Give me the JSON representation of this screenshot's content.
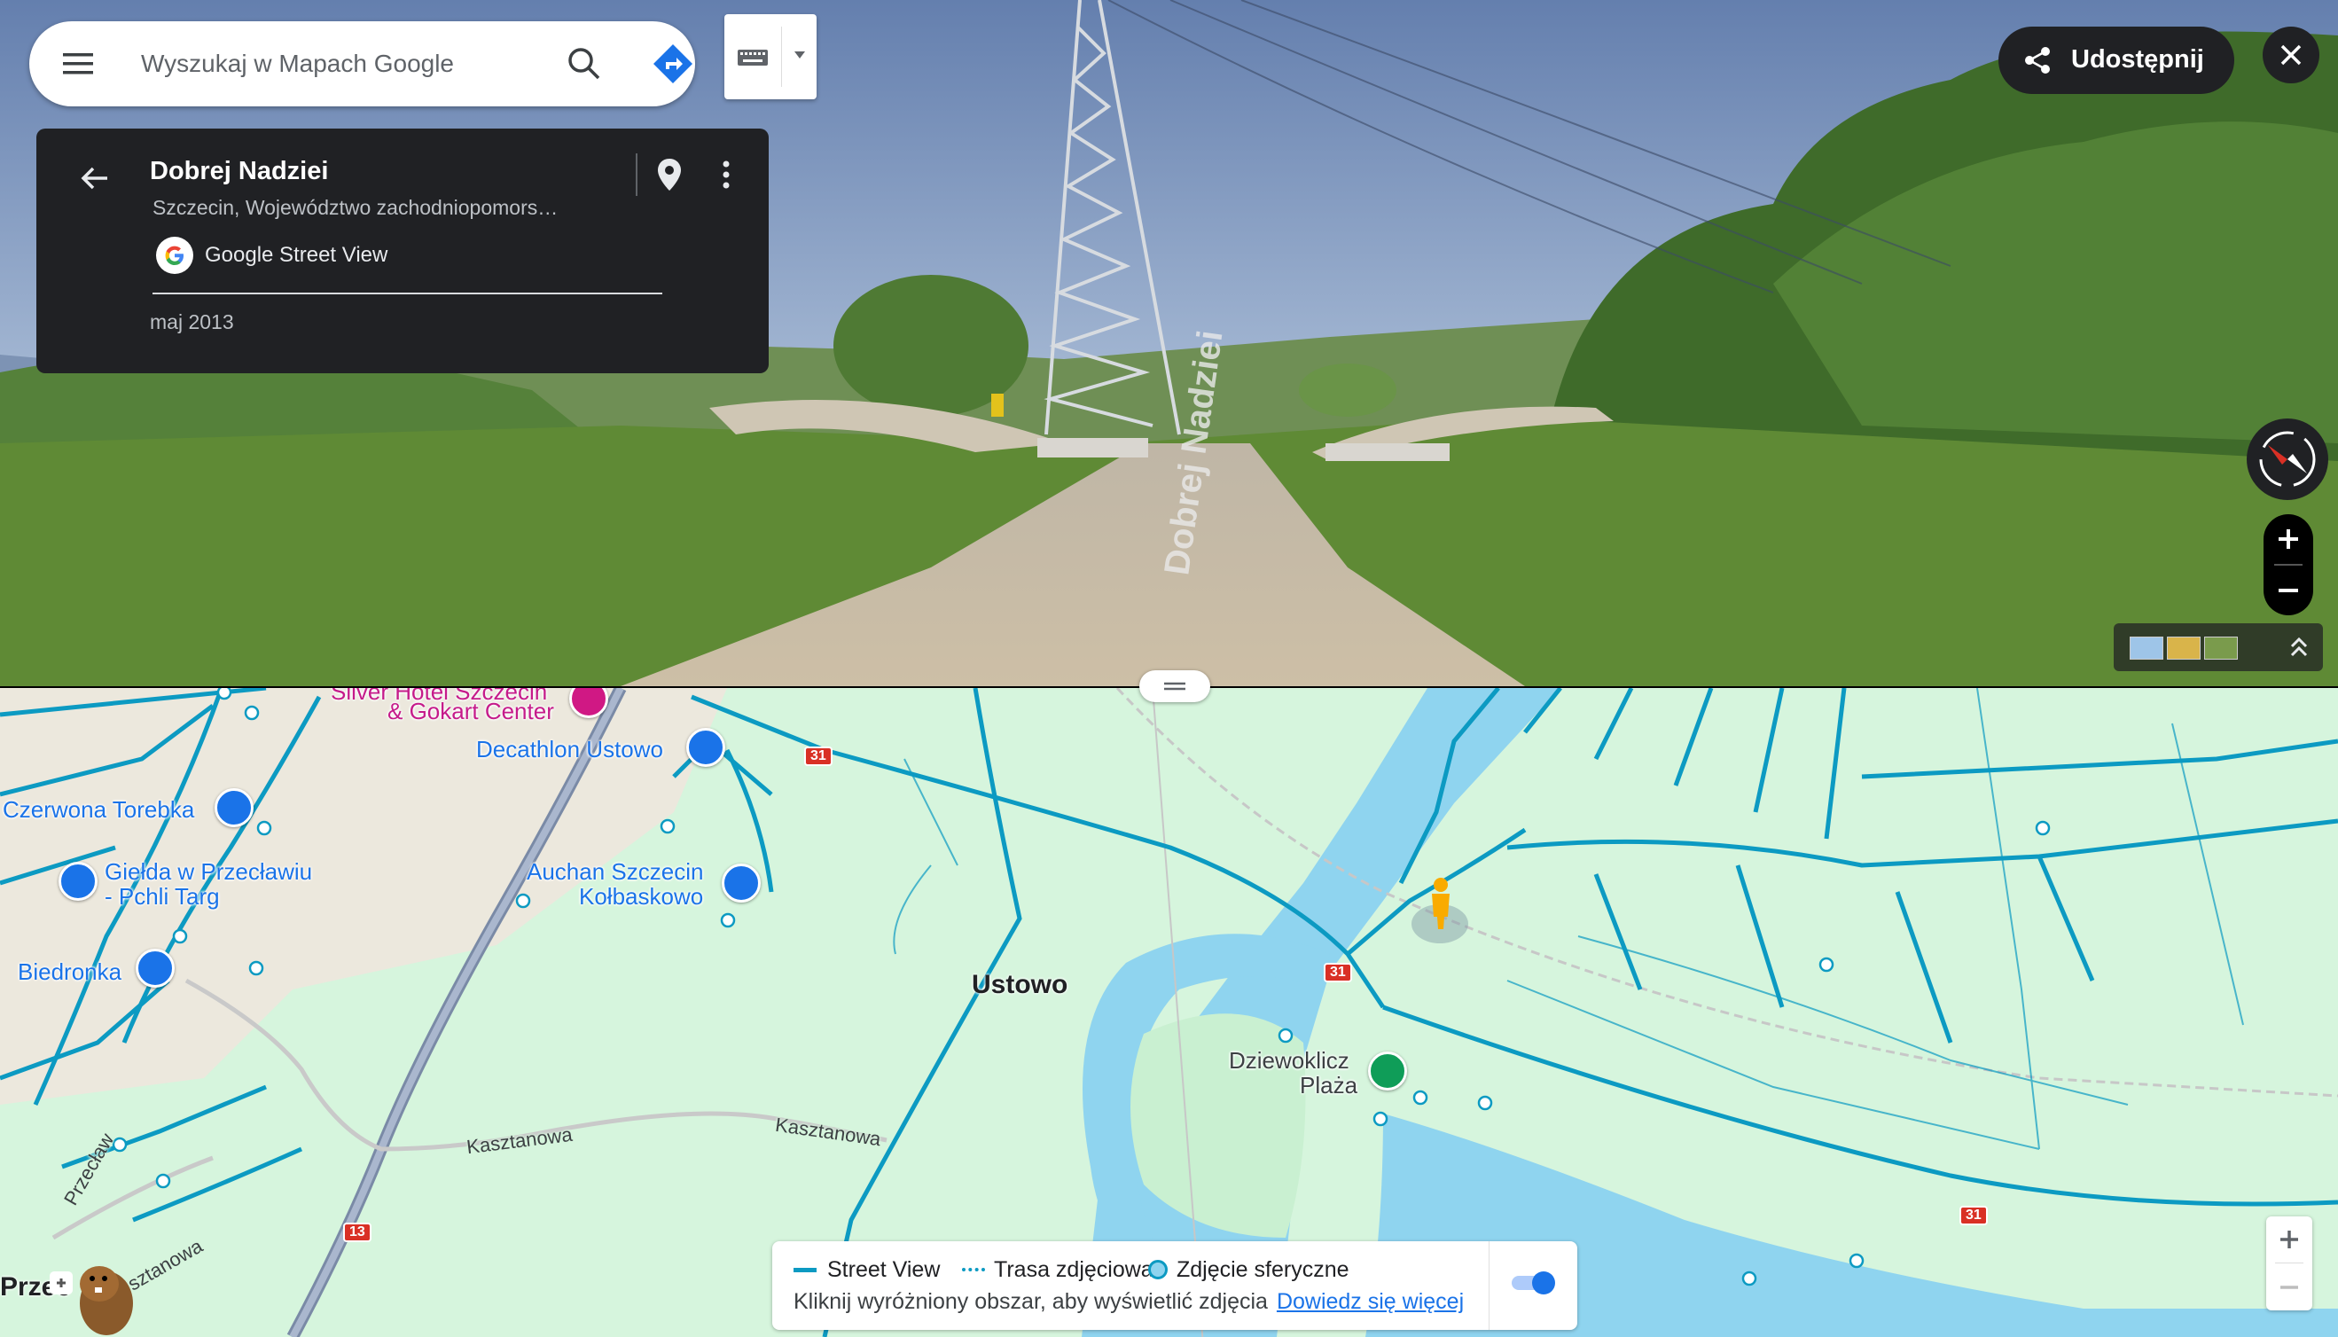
{
  "search": {
    "placeholder": "Wyszukaj w Mapach Google",
    "menu_icon": "hamburger-menu-icon",
    "search_icon": "magnifier-icon",
    "directions_icon": "directions-icon"
  },
  "keyboard": {
    "icon": "keyboard-icon",
    "dropdown_icon": "caret-down-icon"
  },
  "info_card": {
    "title": "Dobrej Nadziei",
    "subtitle": "Szczecin, Województwo zachodniopomors…",
    "source": "Google Street View",
    "date": "maj 2013"
  },
  "share": {
    "label": "Udostępnij"
  },
  "street_view": {
    "road_sign": "Dobrej Nadziei",
    "colors": {
      "sky_top": "#6f87b3",
      "sky_bottom": "#d9e4ee",
      "grass": "#5f8a35",
      "path": "#c4b7a0"
    }
  },
  "map": {
    "pois": {
      "silver_hotel": "Silver Hotel Szczecin",
      "gokart": "& Gokart Center",
      "decathlon": "Decathlon Ustowo",
      "czerwona": "Czerwona Torebka",
      "gielda_1": "Giełda w Przecławiu",
      "gielda_2": "- Pchli Targ",
      "auchan_1": "Auchan Szczecin",
      "auchan_2": "Kołbaskowo",
      "biedronka": "Biedronka",
      "dziewoklicz_1": "Dziewoklicz",
      "dziewoklicz_2": "Plaża"
    },
    "places": {
      "ustowo": "Ustowo",
      "przeclaw_partial": "Przec"
    },
    "roads": {
      "kasztanowa": "Kasztanowa",
      "przeclaw": "Przecław",
      "kasztanowa_partial": "sztanowa"
    },
    "shields": {
      "r31": "31",
      "r13": "13"
    },
    "colors": {
      "land": "#d6f5dd",
      "water": "#8fd4ef",
      "sv_line": "#0c9ac2",
      "urban": "#ece8dd"
    }
  },
  "legend": {
    "street_view": "Street View",
    "photo_route": "Trasa zdjęciowa",
    "spherical": "Zdjęcie sferyczne",
    "hint": "Kliknij wyróżniony obszar, aby wyświetlić zdjęcia",
    "learn_more": "Dowiedz się więcej"
  }
}
